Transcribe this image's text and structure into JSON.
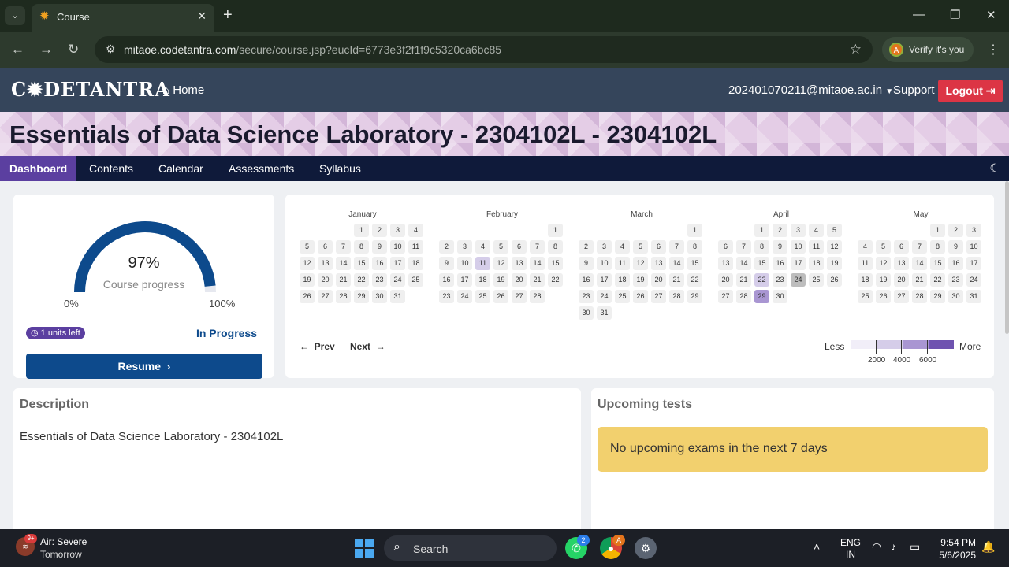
{
  "browser": {
    "tab_title": "Course",
    "url_host": "mitaoe.codetantra.com",
    "url_path": "/secure/course.jsp?eucId=6773e3f2f1f9c5320ca6bc85",
    "verify_label": "Verify it's you",
    "verify_avatar": "A"
  },
  "header": {
    "logo_text": "C✹DETANTRA",
    "home_label": "Home",
    "user_email": "202401070211@mitaoe.ac.in",
    "support_label": "Support",
    "logout_label": "Logout"
  },
  "course": {
    "title": "Essentials of Data Science Laboratory - 2304102L - 2304102L"
  },
  "nav": {
    "tabs": [
      "Dashboard",
      "Contents",
      "Calendar",
      "Assessments",
      "Syllabus"
    ],
    "active": "Dashboard"
  },
  "progress": {
    "value": 0.97,
    "percent_text": "97%",
    "label": "Course progress",
    "min_label": "0%",
    "max_label": "100%",
    "units_left": "1 units left",
    "status": "In Progress",
    "resume_label": "Resume"
  },
  "calendar": {
    "months": [
      {
        "name": "January",
        "offset": 3,
        "days": 31,
        "l1": [],
        "l2": [],
        "today": []
      },
      {
        "name": "February",
        "offset": 6,
        "days": 28,
        "l1": [
          11
        ],
        "l2": [],
        "today": []
      },
      {
        "name": "March",
        "offset": 6,
        "days": 31,
        "l1": [],
        "l2": [],
        "today": []
      },
      {
        "name": "April",
        "offset": 2,
        "days": 30,
        "l1": [
          22
        ],
        "l2": [
          29
        ],
        "today": [
          24
        ]
      },
      {
        "name": "May",
        "offset": 4,
        "days": 31,
        "l1": [],
        "l2": [],
        "today": []
      }
    ],
    "prev_label": "Prev",
    "next_label": "Next",
    "legend_less": "Less",
    "legend_more": "More",
    "legend_ticks": [
      "2000",
      "4000",
      "6000"
    ],
    "legend_colors": [
      "#f1eef8",
      "#d5cde9",
      "#a996d2",
      "#6f53b0"
    ]
  },
  "description": {
    "title": "Description",
    "text": "Essentials of Data Science Laboratory - 2304102L"
  },
  "upcoming": {
    "title": "Upcoming tests",
    "message": "No upcoming exams in the next 7 days"
  },
  "taskbar": {
    "weather_title": "Air: Severe",
    "weather_sub": "Tomorrow",
    "weather_badge": "9+",
    "search_label": "Search",
    "whatsapp_badge": "2",
    "chrome_badge": "A",
    "lang_line1": "ENG",
    "lang_line2": "IN",
    "time": "9:54 PM",
    "date": "5/6/2025"
  }
}
